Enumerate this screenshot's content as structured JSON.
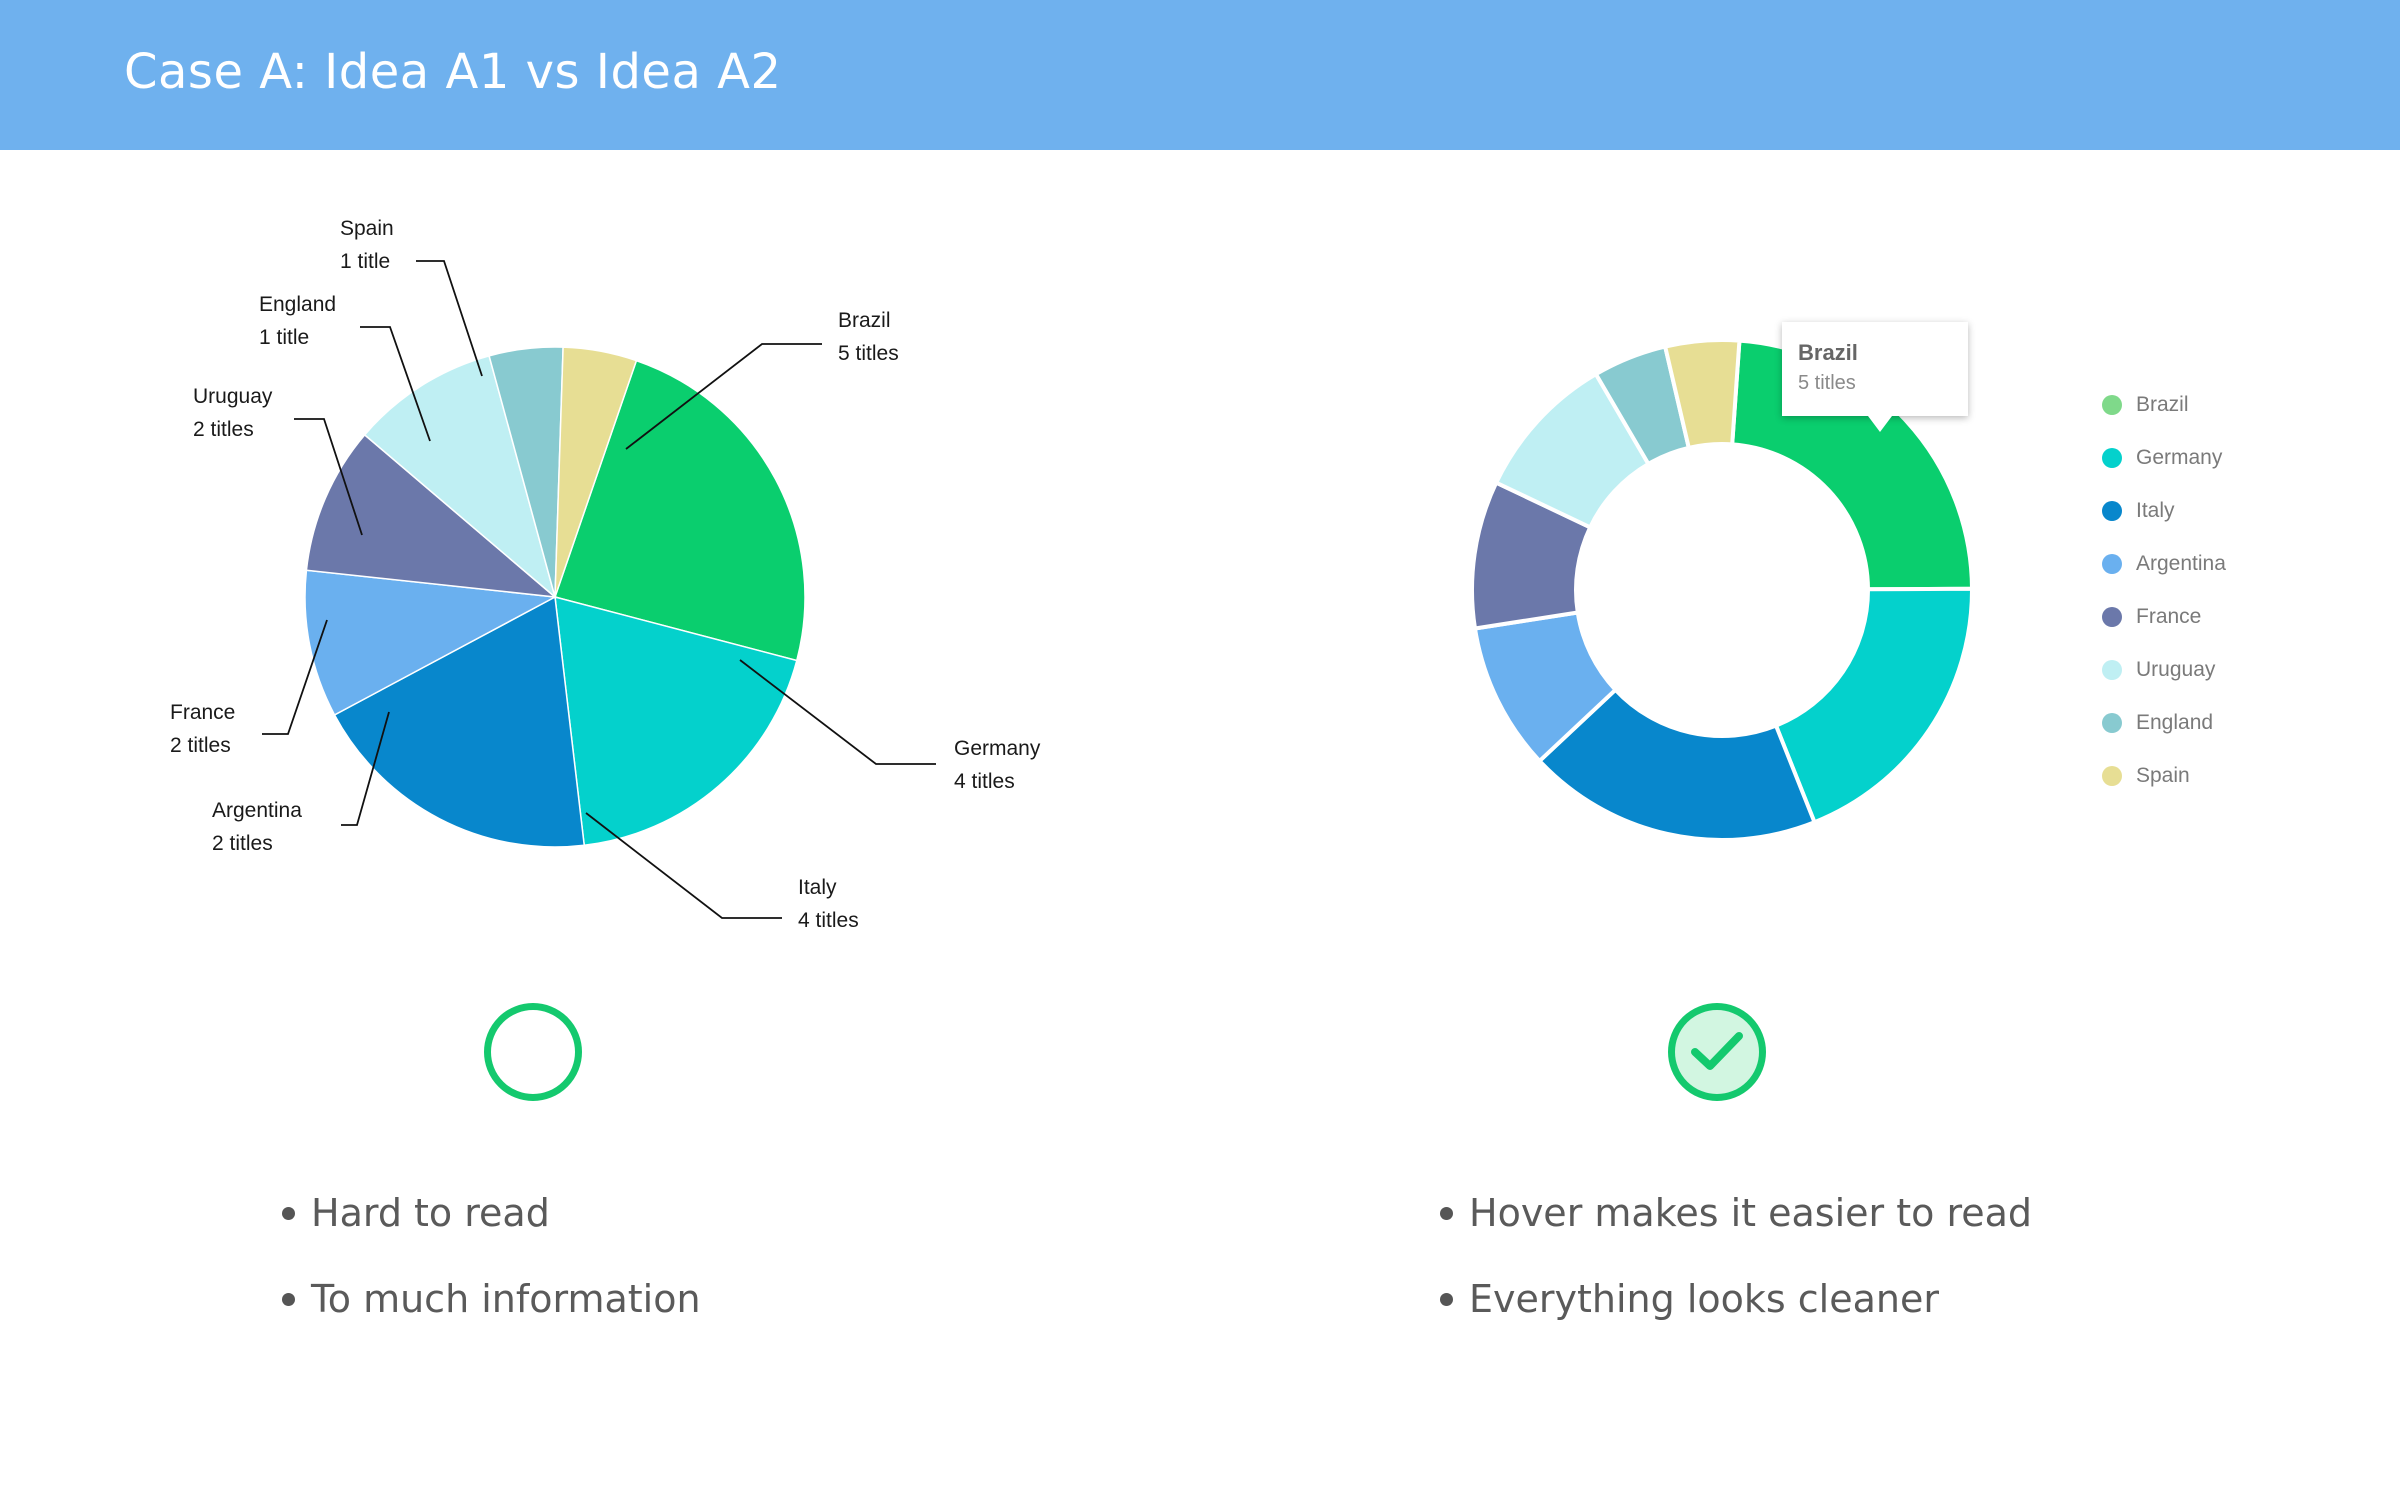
{
  "header": {
    "title": "Case A: Idea A1 vs Idea A2"
  },
  "chart_data": [
    {
      "type": "pie",
      "categories": [
        "Brazil",
        "Germany",
        "Italy",
        "Argentina",
        "France",
        "Uruguay",
        "England",
        "Spain"
      ],
      "values": [
        5,
        4,
        4,
        2,
        2,
        2,
        1,
        1
      ],
      "value_labels": [
        "5 titles",
        "4 titles",
        "4 titles",
        "2 titles",
        "2 titles",
        "2 titles",
        "1 title",
        "1 title"
      ],
      "colors": [
        "#0ace6e",
        "#04d1cc",
        "#0887cc",
        "#6ab0ef",
        "#6b78aa",
        "#bfeff3",
        "#88cad0",
        "#e7de94"
      ],
      "labels_with_leader_lines": true,
      "legend": false
    },
    {
      "type": "pie",
      "variant": "donut",
      "categories": [
        "Brazil",
        "Germany",
        "Italy",
        "Argentina",
        "France",
        "Uruguay",
        "England",
        "Spain"
      ],
      "values": [
        5,
        4,
        4,
        2,
        2,
        2,
        1,
        1
      ],
      "colors": [
        "#0ace6e",
        "#04d1cc",
        "#0887cc",
        "#6ab0ef",
        "#6b78aa",
        "#bfeff3",
        "#88cad0",
        "#e7de94"
      ],
      "legend": "right",
      "legend_colors": [
        "#7fd98a",
        "#04d1cc",
        "#0887cc",
        "#6ab0ef",
        "#6b78aa",
        "#bfeff3",
        "#88cad0",
        "#e7de94"
      ],
      "tooltip": {
        "name": "Brazil",
        "value": "5 titles"
      }
    }
  ],
  "left_panel": {
    "status_icon": "empty-circle-icon",
    "points": [
      "Hard to read",
      "To much information"
    ]
  },
  "right_panel": {
    "status_icon": "check-circle-icon",
    "points": [
      "Hover makes it easier to read",
      "Everything looks cleaner"
    ]
  }
}
